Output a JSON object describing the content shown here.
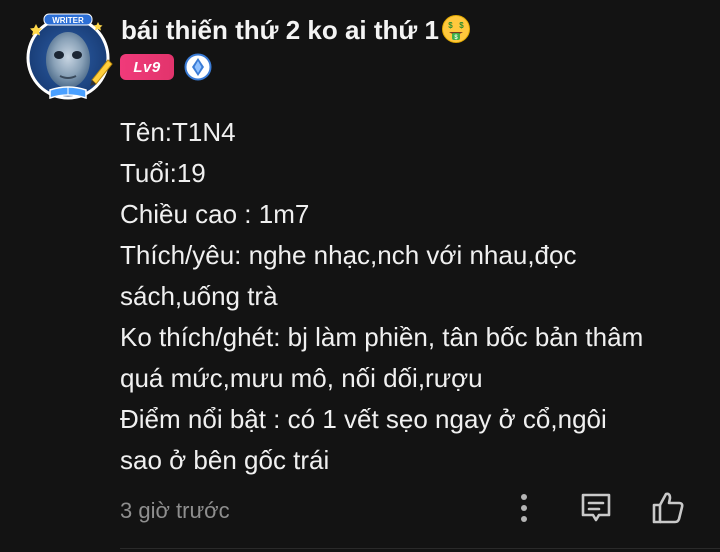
{
  "author": {
    "name": "bái thiến thứ 2 ko ai thứ 1",
    "name_emoji": "money-mouth-face-icon",
    "level_badge": "Lv9",
    "role_icon": "diamond-role-icon",
    "avatar_frame_label": "WRITER"
  },
  "comment": {
    "lines": [
      "Tên:T1N4",
      "Tuổi:19",
      "Chiều cao : 1m7",
      "Thích/yêu: nghe nhạc,nch với nhau,đọc",
      "sách,uống trà",
      "Ko thích/ghét: bj làm phiền, tân bốc bản thâm",
      "quá mức,mưu mô, nối dối,rượu",
      "Điểm nổi bật : có 1 vết sẹo ngay ở cổ,ngôi",
      "sao ở bên gốc trái"
    ],
    "timestamp": "3 giờ trước"
  },
  "actions": {
    "more_icon": "more-vertical-icon",
    "reply_icon": "comment-reply-icon",
    "like_icon": "thumbs-up-icon"
  },
  "colors": {
    "background": "#131313",
    "text": "#f0f0f0",
    "muted": "#8e8e8e",
    "level_badge": "#e8356f",
    "role_badge": "#3a7bd5"
  }
}
